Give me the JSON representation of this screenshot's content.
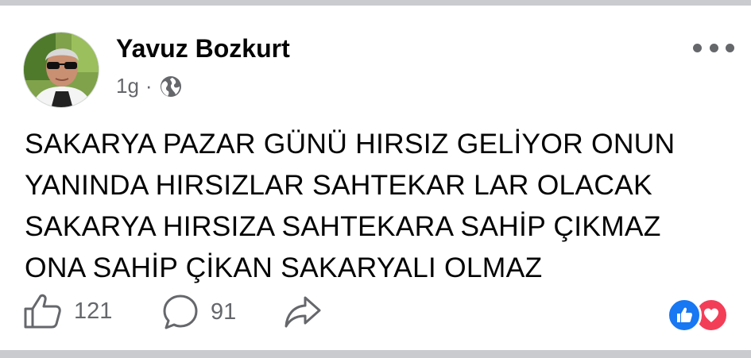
{
  "post": {
    "author": "Yavuz Bozkurt",
    "time": "1g",
    "separator": "·",
    "audience_icon": "globe-icon",
    "more_icon": "more-options-icon",
    "text_lines": [
      "SAKARYA PAZAR GÜNÜ HIRSIZ GELİYOR ONUN",
      "YANINDA HIRSIZLAR SAHTEKAR LAR OLACAK",
      "SAKARYA HIRSIZA SAHTEKARA SAHİP ÇIKMAZ",
      "ONA SAHİP ÇİKAN SAKARYALI OLMAZ"
    ]
  },
  "actions": {
    "like_count": "121",
    "comment_count": "91",
    "like_icon": "thumbs-up-icon",
    "comment_icon": "comment-icon",
    "share_icon": "share-icon"
  },
  "reactions": [
    "like-reaction-icon",
    "love-reaction-icon"
  ],
  "colors": {
    "text": "#050505",
    "secondary": "#65676b",
    "like_blue": "#1877f2",
    "love_red": "#f33e58",
    "divider": "#c9cbcf"
  }
}
